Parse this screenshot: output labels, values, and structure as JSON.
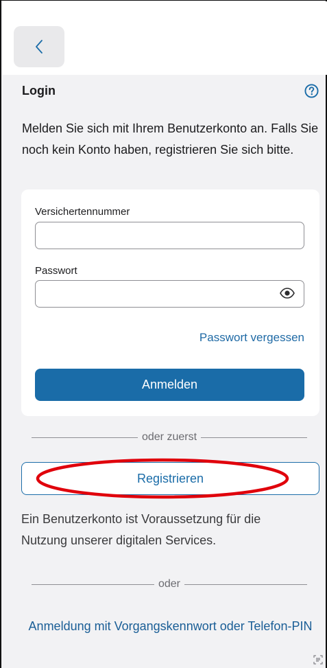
{
  "header": {
    "back_icon": "chevron-left-icon"
  },
  "login": {
    "title": "Login",
    "help_icon": "question-circle-icon",
    "intro": "Melden Sie sich mit Ihrem Benutzerkonto an. Falls Sie noch kein Konto haben, registrieren Sie sich bitte."
  },
  "form": {
    "insurance_number_label": "Versichertennummer",
    "insurance_number_value": "",
    "password_label": "Passwort",
    "password_value": "",
    "password_toggle_icon": "eye-icon",
    "forgot_password": "Passwort vergessen",
    "login_button": "Anmelden"
  },
  "register": {
    "divider_label": "oder zuerst",
    "register_button": "Registrieren",
    "info": "Ein Benutzerkonto ist Voraussetzung für die Nutzung unserer digitalen Services."
  },
  "alternative": {
    "divider_label": "oder",
    "link": "Anmeldung mit Vorgangskennwort oder Telefon-PIN"
  },
  "colors": {
    "accent": "#1a6ca8",
    "highlight": "#e0000b",
    "background": "#f2f2f4"
  }
}
